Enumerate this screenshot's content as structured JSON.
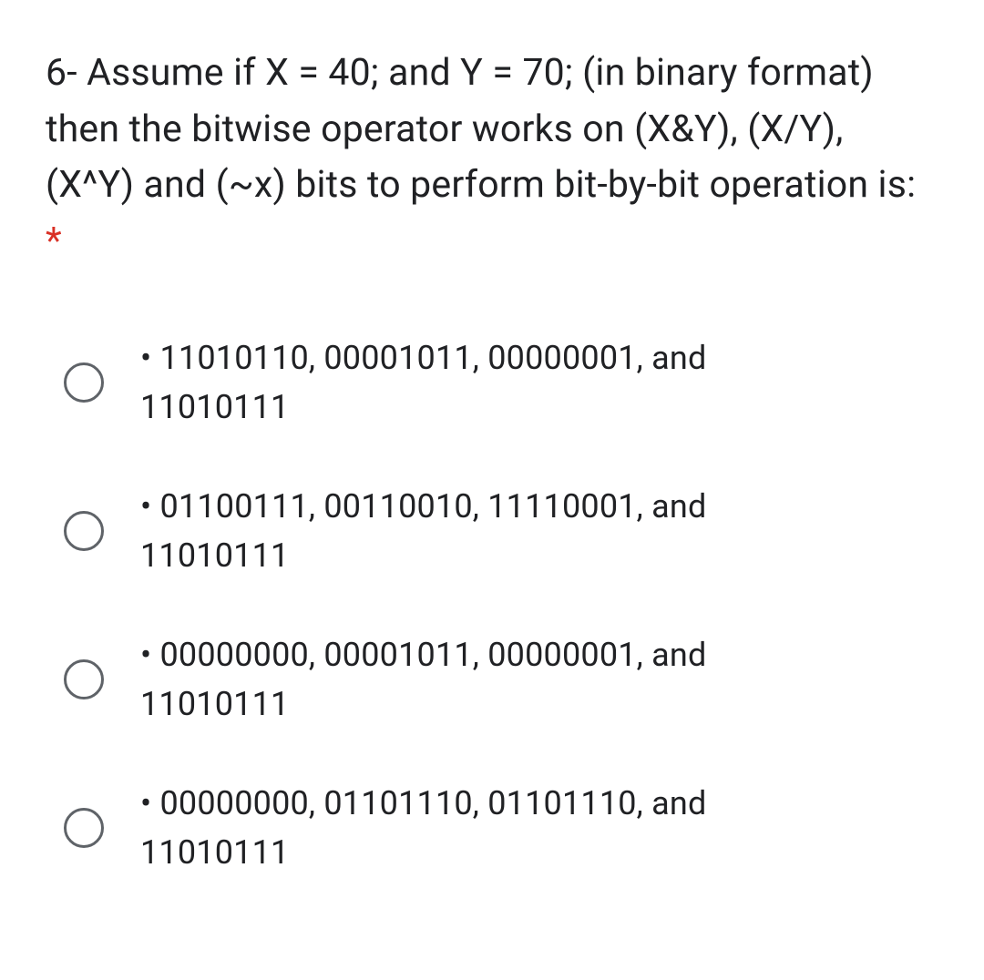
{
  "question": {
    "text": "6- Assume if X = 40; and Y = 70; (in binary format) then the bitwise operator works on (X&Y), (X/Y), (X^Y) and (~x) bits to perform bit-by-bit operation is: ",
    "required_mark": "*"
  },
  "options": [
    {
      "line1": "• 11010110, 00001011, 00000001, and",
      "line2": "11010111"
    },
    {
      "line1": "• 01100111, 00110010, 11110001, and",
      "line2": "11010111"
    },
    {
      "line1": "• 00000000, 00001011, 00000001, and",
      "line2": "11010111"
    },
    {
      "line1": "• 00000000, 01101110, 01101110, and",
      "line2": "11010111"
    }
  ]
}
